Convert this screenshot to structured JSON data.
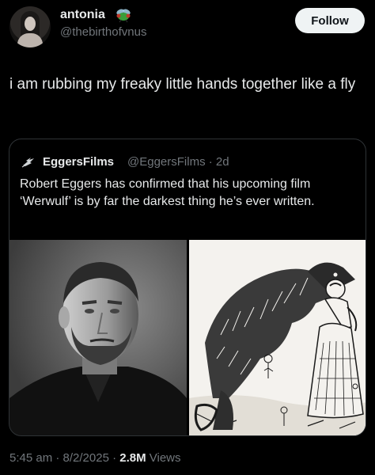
{
  "author": {
    "name": "antonia",
    "handle": "@thebirthofvnus",
    "name_emoji": "fly-emoji"
  },
  "follow_label": "Follow",
  "tweet": {
    "text": "i am rubbing my freaky little hands together like a fly"
  },
  "quote": {
    "name": "EggersFilms",
    "handle_time": "@EggersFilms · 2d",
    "text": "Robert Eggers has confirmed that his upcoming film ‘Werwulf’ is by far the darkest thing he’s ever written.",
    "media": [
      {
        "name": "director-portrait-photo"
      },
      {
        "name": "werewolf-woodcut-illustration"
      }
    ]
  },
  "meta": {
    "time_date": "5:45 am · 8/2/2025 · ",
    "views_count": "2.8M",
    "views_label": " Views"
  },
  "colors": {
    "background": "#000000",
    "text": "#e7e9ea",
    "secondary": "#71767b",
    "border": "#2f3336",
    "follow_bg": "#eff3f4"
  }
}
